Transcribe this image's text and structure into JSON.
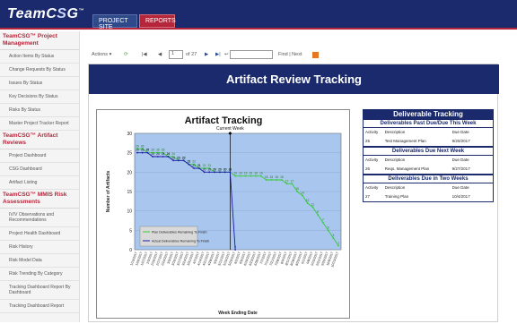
{
  "app": {
    "logo": "TeamC",
    "logo_mark": "S",
    "logo_tail": "G",
    "logo_tm": "™",
    "tabs": [
      {
        "label": "PROJECT SITE"
      },
      {
        "label": "REPORTS"
      }
    ]
  },
  "sidebar": {
    "sections": [
      {
        "title": "TeamCSG™ Project Management",
        "items": [
          "Action Items By Status",
          "Change Requests By Status",
          "Issues By Status",
          "Key Decisions By Status",
          "Risks By Status",
          "Master Project Tracker Report"
        ]
      },
      {
        "title": "TeamCSG™ Artifact Reviews",
        "items": [
          "Project Dashboard",
          "CSG Dashboard",
          "Artifact Listing"
        ]
      },
      {
        "title": "TeamCSG™ MMIS Risk Assessments",
        "items": [
          "IV/V Observations and Recommendations",
          "Project Health Dashboard",
          "Risk History",
          "Risk Model Data",
          "Risk Trending By Category",
          "Tracking Dashboard Report By Dashboard",
          "Tracking Dashboard Report"
        ]
      }
    ]
  },
  "toolbar": {
    "actions_label": "Actions ▾",
    "page_value": "1",
    "page_of": "of 27",
    "find_label": "Find | Next",
    "refresh_glyph": "⟳",
    "first_glyph": "|◀",
    "prev_glyph": "◀",
    "next_glyph": "▶",
    "last_glyph": "▶|",
    "back_glyph": "↩"
  },
  "report": {
    "title": "Artifact Review Tracking",
    "deliverables": {
      "title": "Deliverable Tracking",
      "sections": [
        {
          "heading": "Deliverables Past Due/Due This Week",
          "columns": [
            "Activity",
            "Description",
            "Due Date"
          ],
          "rows": [
            [
              "25",
              "Test Management Plan",
              "9/20/2017"
            ]
          ]
        },
        {
          "heading": "Deliverables Due Next Week",
          "columns": [
            "Activity",
            "Description",
            "Due Date"
          ],
          "rows": [
            [
              "26",
              "Reqs. Management Plan",
              "9/27/2017"
            ]
          ]
        },
        {
          "heading": "Deliverables Due in Two Weeks",
          "columns": [
            "Activity",
            "Description",
            "Due Date"
          ],
          "rows": [
            [
              "27",
              "Training Plan",
              "10/4/2017"
            ]
          ]
        }
      ]
    }
  },
  "chart_data": {
    "type": "line",
    "title": "Artifact Tracking",
    "xlabel": "Week Ending Date",
    "ylabel": "Number of Artifacts",
    "ylim": [
      0,
      30
    ],
    "yticks": [
      0,
      5,
      10,
      15,
      20,
      25,
      30
    ],
    "marker_label": "Current Week",
    "marker_index": 18,
    "x": [
      "1/13/2017",
      "1/20/2017",
      "1/27/2017",
      "2/3/2017",
      "2/10/2017",
      "2/17/2017",
      "2/24/2017",
      "3/3/2017",
      "3/10/2017",
      "3/17/2017",
      "3/24/2017",
      "3/31/2017",
      "4/7/2017",
      "4/14/2017",
      "4/21/2017",
      "4/28/2017",
      "5/5/2017",
      "5/12/2017",
      "5/19/2017",
      "5/26/2017",
      "6/2/2017",
      "6/9/2017",
      "6/16/2017",
      "6/23/2017",
      "6/30/2017",
      "7/7/2017",
      "7/14/2017",
      "7/21/2017",
      "7/28/2017",
      "8/4/2017",
      "8/11/2017",
      "8/18/2017",
      "8/25/2017",
      "9/1/2017",
      "9/8/2017",
      "9/15/2017",
      "9/22/2017",
      "9/29/2017",
      "10/6/2017",
      "10/13/2017"
    ],
    "series": [
      {
        "name": "Plan Deliverables Remaining To Finish",
        "color": "#33cc33",
        "values": [
          26,
          26,
          25,
          25,
          25,
          25,
          24,
          24,
          23,
          23,
          22,
          22,
          21,
          21,
          21,
          20,
          20,
          20,
          20,
          19,
          19,
          19,
          19,
          19,
          19,
          18,
          18,
          18,
          18,
          17,
          17,
          15,
          14,
          12,
          11,
          9,
          7,
          5,
          3,
          1
        ]
      },
      {
        "name": "Actual Deliverables Remaining To Finish",
        "color": "#1a1aa8",
        "values": [
          25,
          25,
          25,
          24,
          24,
          24,
          24,
          23,
          23,
          23,
          22,
          21,
          21,
          20,
          20,
          20,
          20,
          20,
          20,
          0
        ]
      }
    ],
    "legend_position": "bottom-left",
    "grid": true
  }
}
